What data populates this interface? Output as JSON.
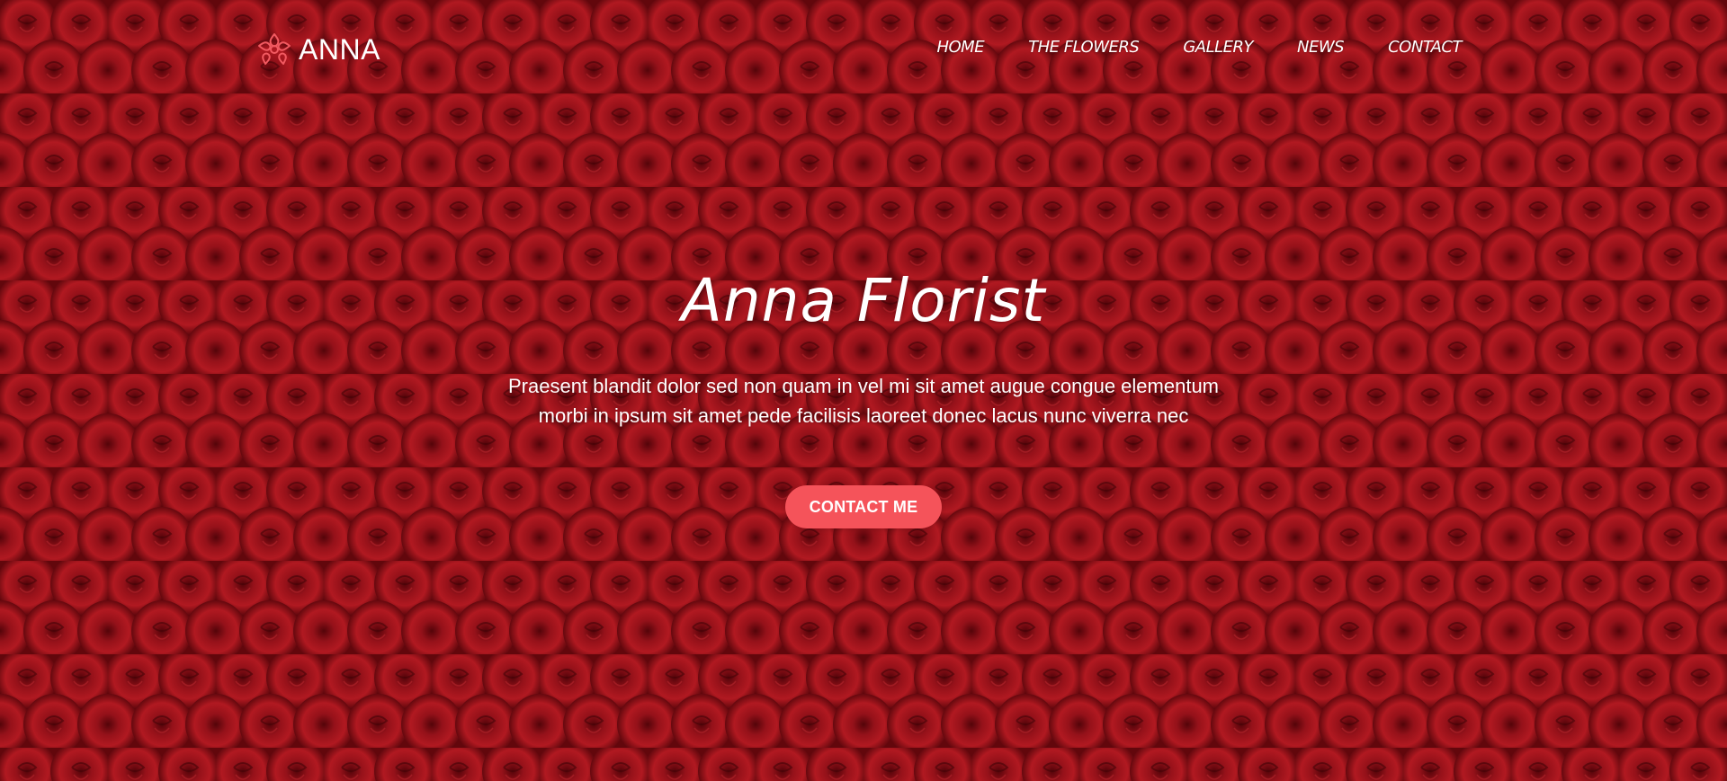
{
  "brand": {
    "name": "ANNA",
    "icon": "flower-icon"
  },
  "nav": {
    "items": [
      {
        "label": "HOME"
      },
      {
        "label": "THE FLOWERS"
      },
      {
        "label": "GALLERY"
      },
      {
        "label": "NEWS"
      },
      {
        "label": "CONTACT"
      }
    ]
  },
  "hero": {
    "title": "Anna Florist",
    "text_line_1": "Praesent blandit dolor sed non quam in vel mi sit amet augue congue elementum",
    "text_line_2": "morbi in ipsum sit amet pede facilisis laoreet donec lacus nunc viverra nec",
    "cta_label": "CONTACT ME",
    "background": "red-roses-background"
  },
  "colors": {
    "accent": "#f5535a",
    "background_red": "#8c0f17",
    "text": "#ffffff"
  }
}
